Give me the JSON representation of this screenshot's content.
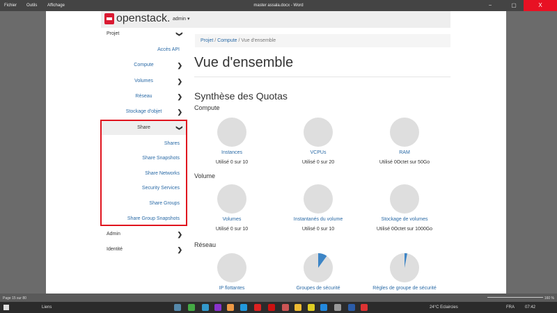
{
  "window": {
    "menu": [
      "Fichier",
      "Outils",
      "Affichage"
    ],
    "title": "master assala.docx  -  Word",
    "close": "X",
    "min": "−",
    "restore": "▢"
  },
  "header": {
    "brand": "openstack.",
    "project_menu": "admin ▾"
  },
  "sidebar": {
    "items": [
      {
        "label": "Projet",
        "type": "top",
        "chev": "❯"
      },
      {
        "label": "Accès API",
        "type": "leaf"
      },
      {
        "label": "Compute",
        "type": "c",
        "chev": "❯"
      },
      {
        "label": "Volumes",
        "type": "c",
        "chev": "❯"
      },
      {
        "label": "Réseau",
        "type": "c",
        "chev": "❯"
      },
      {
        "label": "Stockage d'objet",
        "type": "c",
        "chev": "❯"
      },
      {
        "label": "Share",
        "type": "c",
        "chev": "❯",
        "active": true
      },
      {
        "label": "Shares",
        "type": "leaf"
      },
      {
        "label": "Share Snapshots",
        "type": "leaf"
      },
      {
        "label": "Share Networks",
        "type": "leaf"
      },
      {
        "label": "Security Services",
        "type": "leaf"
      },
      {
        "label": "Share Groups",
        "type": "leaf"
      },
      {
        "label": "Share Group Snapshots",
        "type": "leaf"
      },
      {
        "label": "Admin",
        "type": "top",
        "chev": "❯"
      },
      {
        "label": "Identité",
        "type": "top",
        "chev": "❯"
      }
    ]
  },
  "breadcrumb": {
    "a": "Projet",
    "b": "Compute",
    "c": "Vue d'ensemble",
    "sep": " / "
  },
  "main": {
    "title": "Vue d'ensemble",
    "subtitle": "Synthèse des Quotas",
    "sections": [
      {
        "name": "Compute",
        "items": [
          {
            "label": "Instances",
            "usage": "Utilisé 0 sur 10",
            "fraction": 0
          },
          {
            "label": "VCPUs",
            "usage": "Utilisé 0 sur 20",
            "fraction": 0
          },
          {
            "label": "RAM",
            "usage": "Utilisé 0Octet sur 50Go",
            "fraction": 0
          }
        ]
      },
      {
        "name": "Volume",
        "items": [
          {
            "label": "Volumes",
            "usage": "Utilisé 0 sur 10",
            "fraction": 0
          },
          {
            "label": "Instantanés du volume",
            "usage": "Utilisé 0 sur 10",
            "fraction": 0
          },
          {
            "label": "Stockage de volumes",
            "usage": "Utilisé 0Octet sur 1000Go",
            "fraction": 0
          }
        ]
      },
      {
        "name": "Réseau",
        "items": [
          {
            "label": "IP flottantes",
            "fraction": 0
          },
          {
            "label": "Groupes de sécurité",
            "fraction": 0.1
          },
          {
            "label": "Règles de groupe de sécurité",
            "fraction": 0.03
          }
        ]
      }
    ]
  },
  "colors": {
    "pie_used": "#3d85c6",
    "pie_free": "#dedede"
  },
  "status": {
    "page": "Page 15 sur 80",
    "zoom": "160 %"
  },
  "taskbar": {
    "search": "Liens",
    "weather": "24°C  Eclaircies",
    "lang": "FRA",
    "time": "07:42"
  }
}
